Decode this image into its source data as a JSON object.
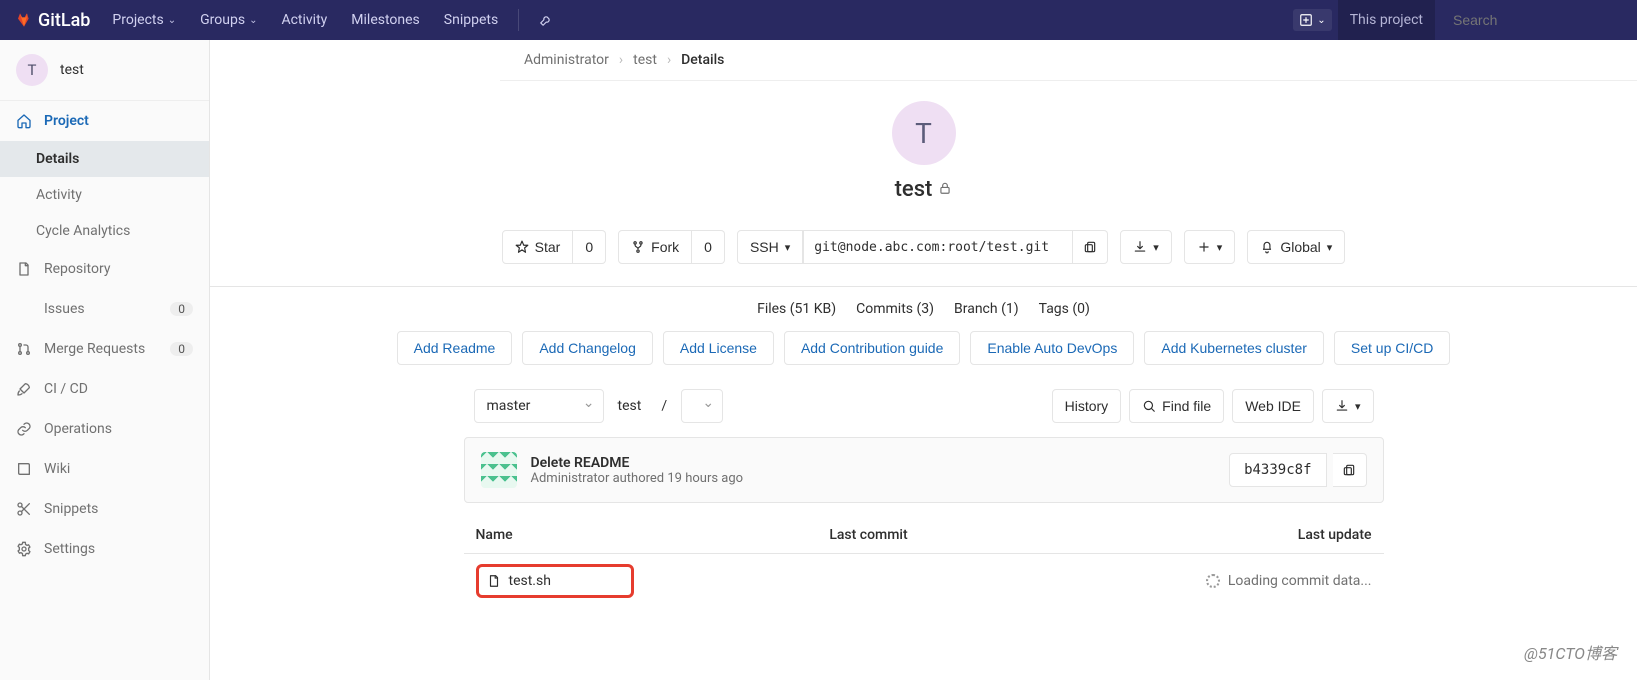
{
  "navbar": {
    "branding": "GitLab",
    "items": {
      "projects": "Projects",
      "groups": "Groups",
      "activity": "Activity",
      "milestones": "Milestones",
      "snippets": "Snippets"
    },
    "search_scope": "This project",
    "search_placeholder": "Search"
  },
  "sidebar": {
    "context_letter": "T",
    "context_name": "test",
    "project_label": "Project",
    "items": {
      "details": "Details",
      "activity": "Activity",
      "cycle_analytics": "Cycle Analytics"
    },
    "repository": "Repository",
    "issues": "Issues",
    "issues_badge": "0",
    "merge_requests": "Merge Requests",
    "mr_badge": "0",
    "cicd": "CI / CD",
    "operations": "Operations",
    "wiki": "Wiki",
    "snippets": "Snippets",
    "settings": "Settings"
  },
  "breadcrumbs": {
    "a": "Administrator",
    "b": "test",
    "c": "Details"
  },
  "project": {
    "avatar_letter": "T",
    "name": "test"
  },
  "actions": {
    "star": "Star",
    "star_count": "0",
    "fork": "Fork",
    "fork_count": "0",
    "protocol": "SSH",
    "clone_url": "git@node.abc.com:root/test.git",
    "notification": "Global"
  },
  "stats": {
    "files": "Files (51 KB)",
    "commits": "Commits (3)",
    "branch": "Branch (1)",
    "tags": "Tags (0)"
  },
  "suggestions": {
    "readme": "Add Readme",
    "changelog": "Add Changelog",
    "license": "Add License",
    "contrib": "Add Contribution guide",
    "autodevops": "Enable Auto DevOps",
    "kubernetes": "Add Kubernetes cluster",
    "cicd": "Set up CI/CD"
  },
  "tree": {
    "branch": "master",
    "path_root": "test",
    "path_sep": "/",
    "history": "History",
    "find_file": "Find file",
    "web_ide": "Web IDE"
  },
  "last_commit": {
    "message": "Delete README",
    "meta": "Administrator authored 19 hours ago",
    "sha": "b4339c8f"
  },
  "file_table": {
    "col_name": "Name",
    "col_last_commit": "Last commit",
    "col_last_update": "Last update",
    "file1": "test.sh",
    "loading": "Loading commit data..."
  },
  "watermark": "@51CTO博客"
}
